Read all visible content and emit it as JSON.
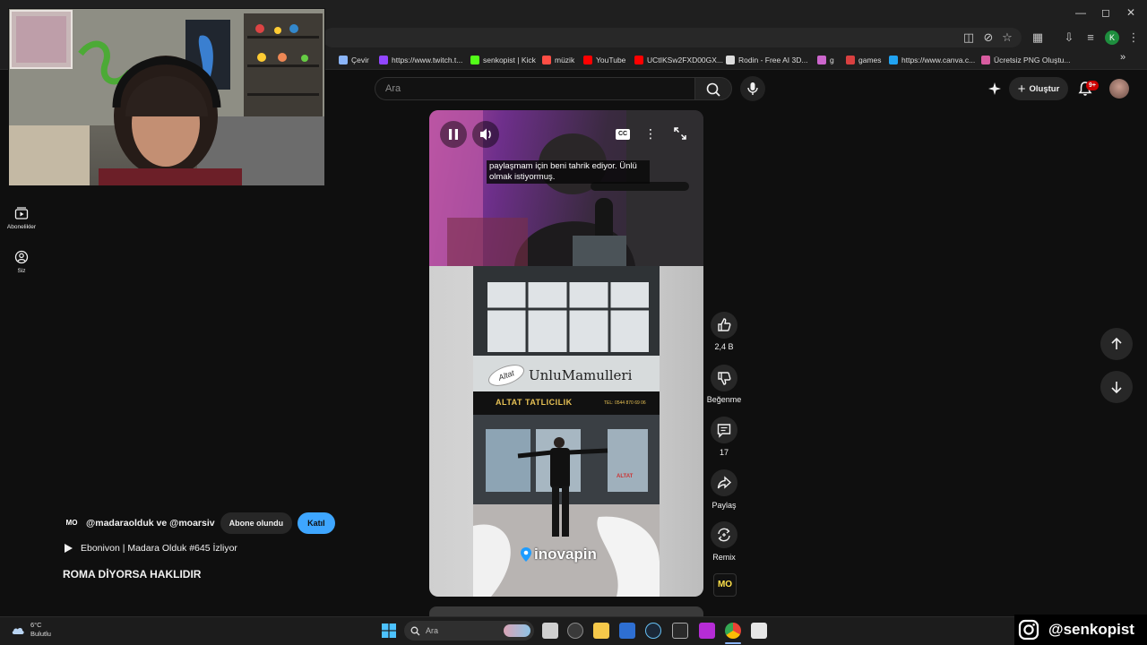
{
  "browser": {
    "bookmarks": [
      {
        "label": "Çevir",
        "color": "#8ab4f8"
      },
      {
        "label": "https://www.twitch.t...",
        "color": "#9146ff"
      },
      {
        "label": "senkopist | Kick",
        "color": "#53fc18"
      },
      {
        "label": "müzik",
        "color": "#ff4e45"
      },
      {
        "label": "YouTube",
        "color": "#ff0000"
      },
      {
        "label": "UCtIKSw2FXD00GX...",
        "color": "#ff0000"
      },
      {
        "label": "Rodin - Free AI 3D...",
        "color": "#dddddd"
      },
      {
        "label": "g",
        "color": "#cc66cc"
      },
      {
        "label": "games",
        "color": "#d94040"
      },
      {
        "label": "https://www.canva.c...",
        "color": "#21a3f1"
      },
      {
        "label": "Ücretsiz PNG Oluştu...",
        "color": "#d85ca0"
      }
    ],
    "more_bookmarks": "»",
    "profile_initial": "K"
  },
  "youtube": {
    "search_placeholder": "Ara",
    "create_label": "Oluştur",
    "notif_count": "9+",
    "sidebar": [
      {
        "label": "Abonelikler"
      },
      {
        "label": "Siz"
      }
    ]
  },
  "short": {
    "caption": "paylaşmam için beni tahrik ediyor. Ünlü olmak istiyormuş.",
    "cc_label": "CC",
    "store_sign": "UnluMamulleri",
    "store_badge": "Altat",
    "store_subsign": "ALTAT TATLICILIK",
    "phone": "TEL: 0544 870 69 06",
    "door_sign": "ALTAT",
    "watermark": "inovapin",
    "like_count": "2,4 B",
    "dislike_label": "Beğenme",
    "comment_count": "17",
    "share_label": "Paylaş",
    "remix_label": "Remix",
    "channel_logo": "MO",
    "channel_names": "@madaraolduk ve @moarsiv",
    "subscribed_label": "Abone olundu",
    "join_label": "Katıl",
    "now_playing": "Ebonivon | Madara Olduk #645 İzliyor",
    "title": "ROMA DİYORSA HAKLIDIR"
  },
  "taskbar": {
    "weather_temp": "6°C",
    "weather_desc": "Bulutlu",
    "search_placeholder": "Ara"
  },
  "overlay": {
    "instagram_handle": "@senkopist"
  }
}
